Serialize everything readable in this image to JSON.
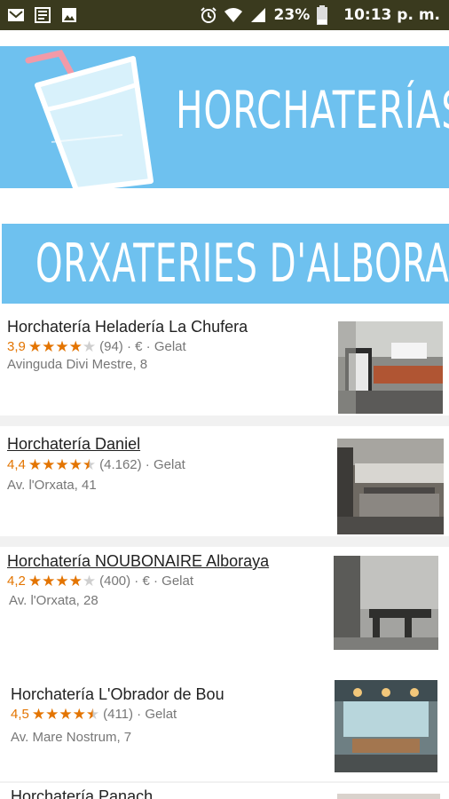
{
  "status_bar": {
    "battery": "23%",
    "time": "10:13 p. m."
  },
  "banners": {
    "title": "HORCHATERÍAS",
    "subtitle": "ORXATERIES D'ALBORAIA"
  },
  "places": [
    {
      "name": "Horchatería Heladería La Chufera",
      "rating": "3,9",
      "stars": 3.9,
      "reviews": "(94)",
      "price": "€",
      "category": "Gelat",
      "address": "Avinguda Divi Mestre, 8"
    },
    {
      "name": "Horchatería Daniel",
      "rating": "4,4",
      "stars": 4.4,
      "reviews": "(4.162)",
      "price": "",
      "category": "Gelat",
      "address": "Av. l'Orxata, 41"
    },
    {
      "name": "Horchatería NOUBONAIRE Alboraya",
      "rating": "4,2",
      "stars": 4.2,
      "reviews": "(400)",
      "price": "€",
      "category": "Gelat",
      "address": "Av. l'Orxata, 28"
    },
    {
      "name": "Horchatería L'Obrador de Bou",
      "rating": "4,5",
      "stars": 4.5,
      "reviews": "(411)",
      "price": "",
      "category": "Gelat",
      "address": "Av. Mare Nostrum, 7"
    },
    {
      "name": "Horchatería Panach",
      "rating": "",
      "stars": 0,
      "reviews": "",
      "price": "",
      "category": "",
      "address": ""
    }
  ],
  "colors": {
    "banner": "#6ec1ef",
    "star": "#e37400",
    "status_bar": "#3a3a1e"
  }
}
